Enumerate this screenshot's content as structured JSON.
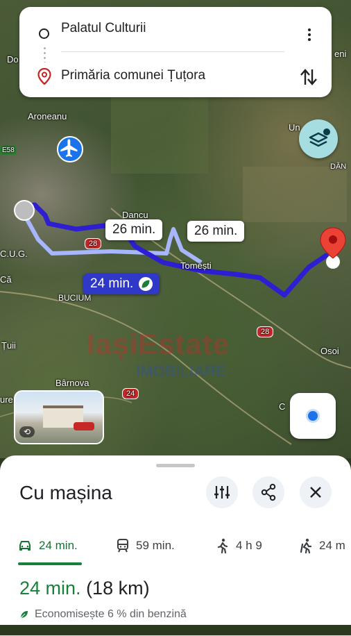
{
  "search": {
    "origin": "Palatul Culturii",
    "destination": "Primăria comunei Țuțora",
    "origin_icon": "origin-circle-icon",
    "destination_icon": "location-pin-icon",
    "more_icon": "more-vert-icon",
    "swap_icon": "swap-vert-icon"
  },
  "map": {
    "places": [
      "Do",
      "Aroneanu",
      "E58",
      "Dancu",
      "Tomești",
      "C.U.G.",
      "Că",
      "BUCIUM",
      "Țuii",
      "Bârnova",
      "ure",
      "C",
      "Osoi",
      "Un",
      "eni",
      "DĂN"
    ],
    "road_badges": [
      "28",
      "28",
      "24"
    ],
    "routes": [
      {
        "label": "24 min.",
        "selected": true,
        "eco_icon": "leaf-icon"
      },
      {
        "label": "26 min.",
        "selected": false
      },
      {
        "label": "26 min.",
        "selected": false
      }
    ],
    "watermark": "IașiEstate IMOBILIARE",
    "colors": {
      "selected_route": "#2d1fd1",
      "alt_route": "#a7b6ff",
      "destination_pin": "#ea4335",
      "layers_button": "#a6dde0"
    }
  },
  "controls": {
    "layers_icon": "layers-icon",
    "locate_icon": "my-location-icon",
    "airport_icon": "airplane-icon",
    "street_view_icon": "street-view-rotate-icon"
  },
  "sheet": {
    "title": "Cu mașina",
    "filter_icon": "tune-icon",
    "share_icon": "share-icon",
    "close_icon": "close-icon",
    "tabs": [
      {
        "mode": "car",
        "icon": "car-icon",
        "label": "24 min.",
        "active": true
      },
      {
        "mode": "transit",
        "icon": "train-icon",
        "label": "59 min.",
        "active": false
      },
      {
        "mode": "walk",
        "icon": "walk-icon",
        "label": "4 h 9",
        "active": false
      },
      {
        "mode": "ride",
        "icon": "ride-icon",
        "label": "24 m",
        "active": false
      }
    ],
    "summary_time": "24 min.",
    "summary_distance": "(18 km)",
    "eco_text": "Economisește 6 % din benzină",
    "accent_color": "#188038"
  }
}
